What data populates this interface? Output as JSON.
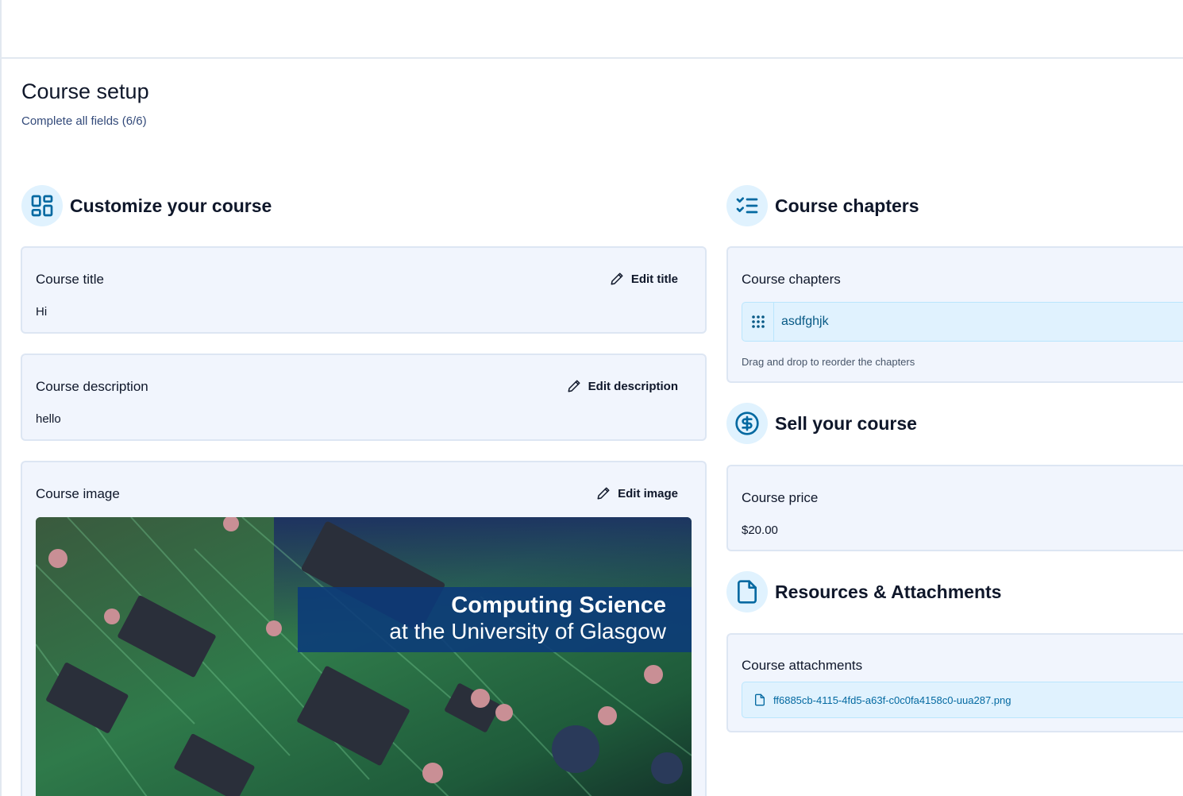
{
  "header": {
    "title": "Course setup",
    "subtitle": "Complete all fields (6/6)"
  },
  "customize": {
    "heading": "Customize your course",
    "icon": "layout-dashboard-icon",
    "title_card": {
      "label": "Course title",
      "edit_label": "Edit title",
      "value": "Hi"
    },
    "description_card": {
      "label": "Course description",
      "edit_label": "Edit description",
      "value": "hello"
    },
    "image_card": {
      "label": "Course image",
      "edit_label": "Edit image",
      "banner_line1": "Computing Science",
      "banner_line2": "at the University of Glasgow"
    }
  },
  "chapters": {
    "heading": "Course chapters",
    "icon": "list-checks-icon",
    "card_label": "Course chapters",
    "items": [
      {
        "title": "asdfghjk"
      }
    ],
    "hint": "Drag and drop to reorder the chapters"
  },
  "sell": {
    "heading": "Sell your course",
    "icon": "circle-dollar-icon",
    "card_label": "Course price",
    "price": "$20.00"
  },
  "resources": {
    "heading": "Resources & Attachments",
    "icon": "file-icon",
    "card_label": "Course attachments",
    "attachments": [
      {
        "name": "ff6885cb-4115-4fd5-a63f-c0c0fa4158c0-uua287.png"
      }
    ]
  },
  "colors": {
    "accent": "#0369a1",
    "icon_bg": "#e0f2fe",
    "card_bg": "#f1f5fd"
  }
}
